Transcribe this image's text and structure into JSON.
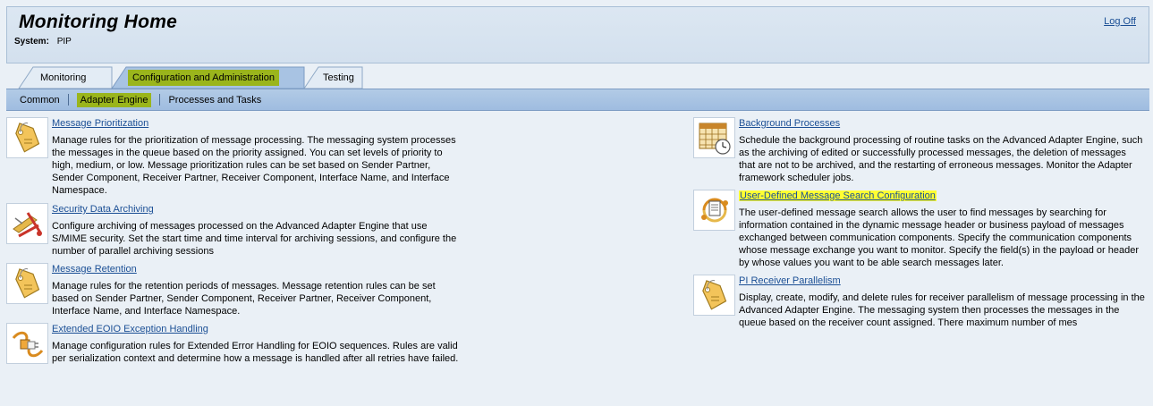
{
  "header": {
    "title": "Monitoring Home",
    "logoff_label": "Log Off",
    "system_label": "System:",
    "system_value": "PIP"
  },
  "tabs": [
    {
      "label": "Monitoring",
      "active": false
    },
    {
      "label": "Configuration and Administration",
      "active": true
    },
    {
      "label": "Testing",
      "active": false
    }
  ],
  "subnav": [
    {
      "label": "Common",
      "active": false
    },
    {
      "label": "Adapter Engine",
      "active": true
    },
    {
      "label": "Processes and Tasks",
      "active": false
    }
  ],
  "left_items": [
    {
      "icon": "tag-icon",
      "title": "Message Prioritization",
      "desc_lines": [
        "Manage rules for the prioritization of message processing. The messaging system processes",
        "the messages in the queue based on the priority assigned. You can set levels of priority to",
        "high, medium, or low. Message prioritization rules can be set based on Sender Partner,",
        "Sender Component, Receiver Partner, Receiver Component, Interface Name, and Interface",
        "Namespace."
      ]
    },
    {
      "icon": "security-archive-icon",
      "title": "Security Data Archiving",
      "desc_lines": [
        "Configure archiving of messages processed on the Advanced Adapter Engine that use",
        "S/MIME security. Set the start time and time interval for archiving  sessions, and configure the",
        "number of parallel archiving sessions"
      ]
    },
    {
      "icon": "tag-icon",
      "title": "Message Retention",
      "desc_lines": [
        "Manage rules for the retention periods of messages. Message retention rules can be set",
        "based on Sender Partner, Sender Component, Receiver Partner, Receiver Component,",
        "Interface Name, and Interface Namespace."
      ]
    },
    {
      "icon": "plug-icon",
      "title": "Extended EOIO Exception Handling",
      "desc_lines": [
        "Manage configuration rules for Extended Error Handling for EOIO sequences. Rules are valid",
        "per serialization context and determine how a message is handled after all retries have failed."
      ]
    }
  ],
  "right_items": [
    {
      "icon": "calendar-clock-icon",
      "title": "Background Processes",
      "highlighted": false,
      "desc_lines": [
        "Schedule the background processing of routine tasks on the Advanced Adapter Engine, such",
        "as the archiving of edited or successfully processed messages, the deletion of messages",
        "that are not to be archived, and the restarting of erroneous messages. Monitor the Adapter",
        "framework scheduler jobs."
      ]
    },
    {
      "icon": "message-search-icon",
      "title": "User-Defined Message Search Configuration",
      "highlighted": true,
      "desc_lines": [
        "The user-defined message search allows the user to find messages by searching for",
        "information contained in the dynamic message header or business payload of messages",
        "exchanged between communication components. Specify the communication components",
        "whose message exchange you want to monitor. Specify the field(s) in the payload or header",
        "by whose values you want to be able search messages later."
      ]
    },
    {
      "icon": "tag-icon",
      "title": "PI Receiver Parallelism",
      "highlighted": false,
      "desc_lines": [
        "Display, create, modify, and delete rules for receiver parallelism of message processing in the",
        "Advanced Adapter Engine. The messaging system then processes the messages in the",
        "queue based on the receiver count assigned. There maximum number of mes"
      ]
    }
  ],
  "colors": {
    "link": "#1b4f95",
    "tab_highlight": "#9ab51c",
    "search_highlight": "#ffff33",
    "background": "#eaf0f6"
  }
}
